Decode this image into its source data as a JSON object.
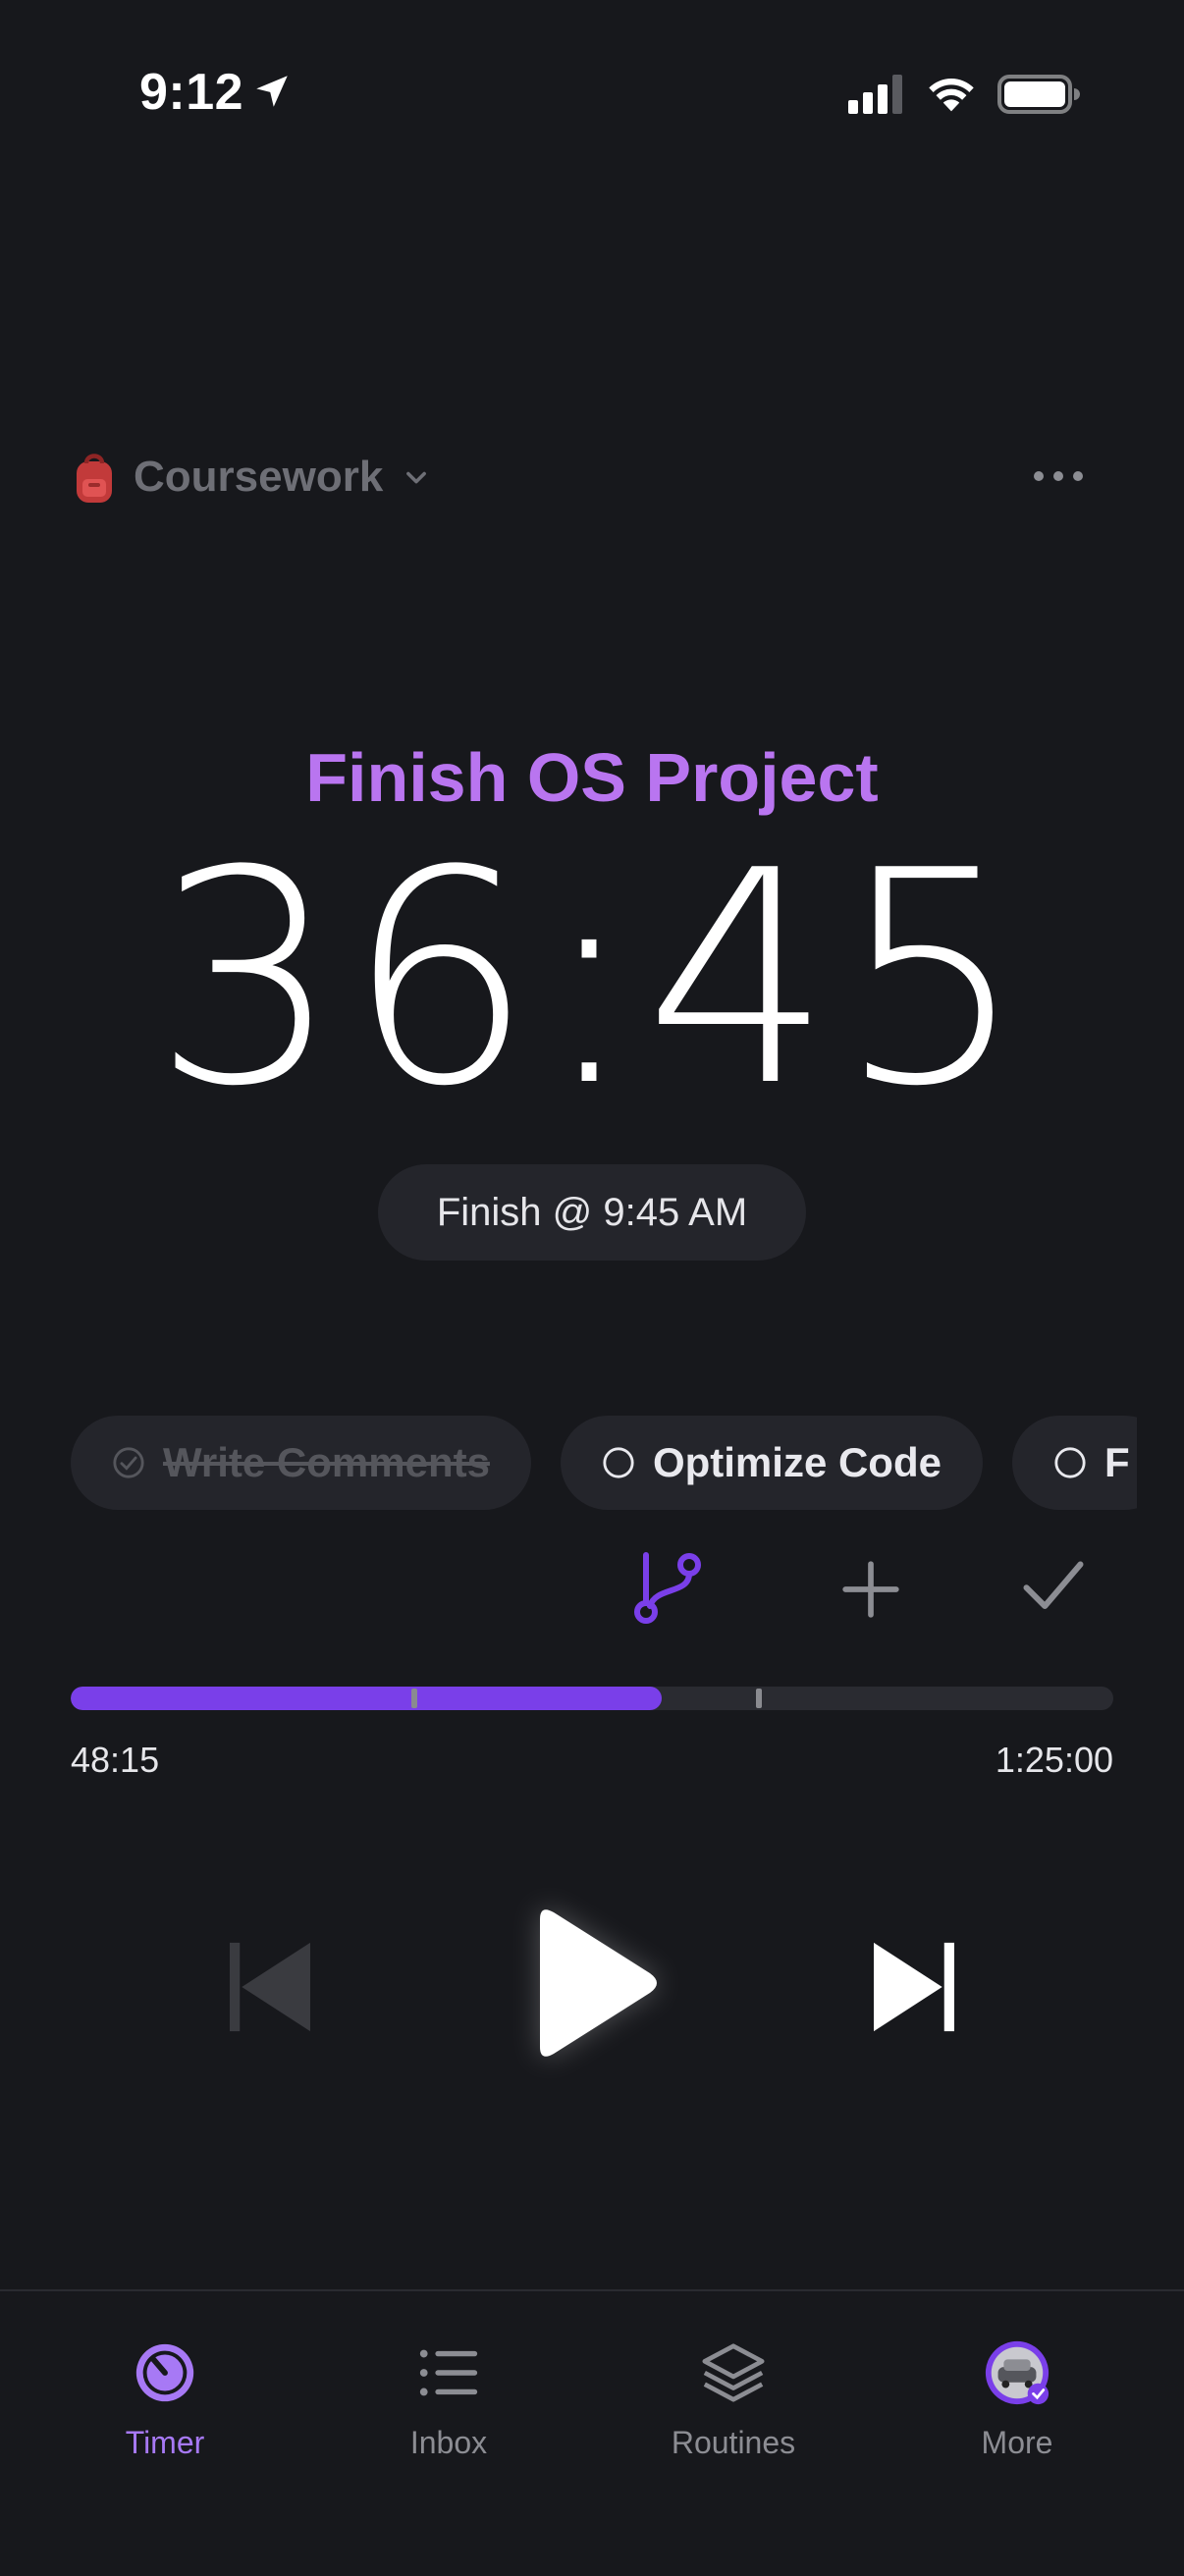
{
  "status_bar": {
    "time": "9:12",
    "icons": [
      "location-arrow-icon",
      "cellular-signal-icon",
      "wifi-icon",
      "battery-icon"
    ]
  },
  "header": {
    "project_icon": "backpack-icon",
    "project_name": "Coursework",
    "more_icon": "ellipsis-icon"
  },
  "task": {
    "title": "Finish OS Project",
    "time_remaining": "36:45",
    "finish_label": "Finish @ 9:45 AM"
  },
  "subtasks": [
    {
      "label": "Write Comments",
      "done": true
    },
    {
      "label": "Optimize Code",
      "done": false
    },
    {
      "label": "F",
      "done": false
    }
  ],
  "actions": {
    "icons": [
      "branch-icon",
      "plus-icon",
      "checkmark-icon"
    ]
  },
  "progress": {
    "elapsed_label": "48:15",
    "total_label": "1:25:00",
    "fraction": 0.567,
    "markers": [
      0.33,
      0.66
    ]
  },
  "controls": {
    "icons": [
      "skip-back-icon",
      "play-icon",
      "skip-forward-icon"
    ]
  },
  "tabs": [
    {
      "label": "Timer",
      "icon": "timer-icon",
      "active": true
    },
    {
      "label": "Inbox",
      "icon": "list-icon",
      "active": false
    },
    {
      "label": "Routines",
      "icon": "layers-icon",
      "active": false
    },
    {
      "label": "More",
      "icon": "avatar-icon",
      "active": false
    }
  ],
  "colors": {
    "background": "#17181c",
    "accent": "#7a3fe9",
    "title": "#b975f0",
    "chip": "#24252b"
  }
}
